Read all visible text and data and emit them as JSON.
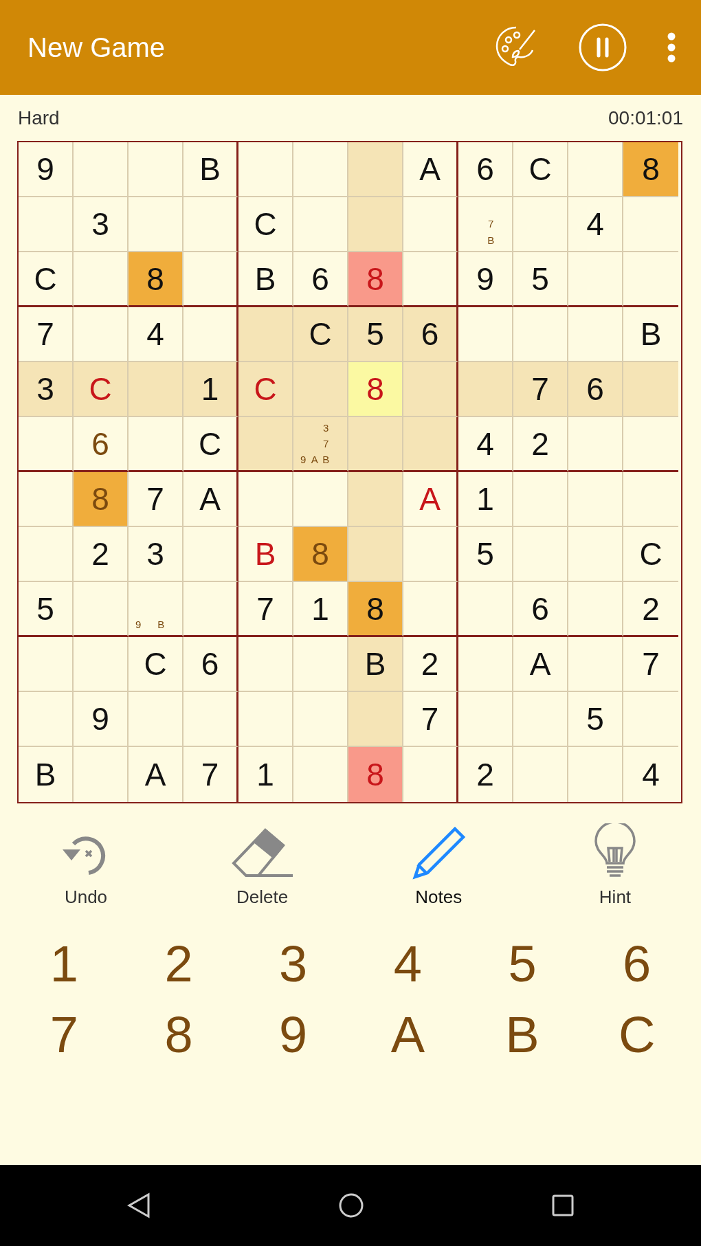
{
  "app_bar": {
    "title": "New Game"
  },
  "status": {
    "difficulty": "Hard",
    "timer": "00:01:01"
  },
  "board": {
    "rows": [
      {
        "cells": [
          {
            "value": "9",
            "kind": "given",
            "matched": false,
            "conflict": false,
            "selected": false
          },
          {
            "selected": false
          },
          {
            "selected": false
          },
          {
            "value": "B",
            "kind": "given",
            "matched": false,
            "conflict": false,
            "selected": false
          },
          {
            "selected": false
          },
          {
            "selected": false
          },
          {
            "selected": false
          },
          {
            "value": "A",
            "kind": "given",
            "matched": false,
            "conflict": false,
            "selected": false
          },
          {
            "value": "6",
            "kind": "given",
            "matched": false,
            "conflict": false,
            "selected": false
          },
          {
            "value": "C",
            "kind": "given",
            "matched": false,
            "conflict": false,
            "selected": false
          },
          {
            "selected": false
          },
          {
            "value": "8",
            "kind": "given",
            "matched": true,
            "conflict": false,
            "selected": false
          }
        ]
      },
      {
        "cells": [
          {
            "selected": false
          },
          {
            "value": "3",
            "kind": "given",
            "matched": false,
            "conflict": false,
            "selected": false
          },
          {
            "selected": false
          },
          {
            "selected": false
          },
          {
            "value": "C",
            "kind": "given",
            "matched": false,
            "conflict": false,
            "selected": false
          },
          {
            "selected": false
          },
          {
            "selected": false
          },
          {
            "selected": false
          },
          {
            "notes": [
              "7",
              "B"
            ],
            "selected": false
          },
          {
            "selected": false
          },
          {
            "value": "4",
            "kind": "given",
            "matched": false,
            "conflict": false,
            "selected": false
          },
          {
            "selected": false
          }
        ]
      },
      {
        "cells": [
          {
            "value": "C",
            "kind": "given",
            "matched": false,
            "conflict": false,
            "selected": false
          },
          {
            "selected": false
          },
          {
            "value": "8",
            "kind": "given",
            "matched": true,
            "conflict": false,
            "selected": false
          },
          {
            "selected": false
          },
          {
            "value": "B",
            "kind": "given",
            "matched": false,
            "conflict": false,
            "selected": false
          },
          {
            "value": "6",
            "kind": "given",
            "matched": false,
            "conflict": false,
            "selected": false
          },
          {
            "value": "8",
            "kind": "error",
            "matched": true,
            "conflict": true,
            "selected": false
          },
          {
            "selected": false
          },
          {
            "value": "9",
            "kind": "given",
            "matched": false,
            "conflict": false,
            "selected": false
          },
          {
            "value": "5",
            "kind": "given",
            "matched": false,
            "conflict": false,
            "selected": false
          },
          {
            "selected": false
          },
          {
            "selected": false
          }
        ]
      },
      {
        "cells": [
          {
            "value": "7",
            "kind": "given",
            "matched": false,
            "conflict": false,
            "selected": false
          },
          {
            "selected": false
          },
          {
            "value": "4",
            "kind": "given",
            "matched": false,
            "conflict": false,
            "selected": false
          },
          {
            "selected": false
          },
          {
            "selected": false
          },
          {
            "value": "C",
            "kind": "given",
            "matched": false,
            "conflict": false,
            "selected": false
          },
          {
            "value": "5",
            "kind": "given",
            "matched": false,
            "conflict": false,
            "selected": false
          },
          {
            "value": "6",
            "kind": "given",
            "matched": false,
            "conflict": false,
            "selected": false
          },
          {
            "selected": false
          },
          {
            "selected": false
          },
          {
            "selected": false
          },
          {
            "value": "B",
            "kind": "given",
            "matched": false,
            "conflict": false,
            "selected": false
          }
        ]
      },
      {
        "cells": [
          {
            "value": "3",
            "kind": "given",
            "matched": false,
            "conflict": false,
            "selected": false
          },
          {
            "value": "C",
            "kind": "error",
            "matched": false,
            "conflict": false,
            "selected": false
          },
          {
            "selected": false
          },
          {
            "value": "1",
            "kind": "given",
            "matched": false,
            "conflict": false,
            "selected": false
          },
          {
            "value": "C",
            "kind": "error",
            "matched": false,
            "conflict": false,
            "selected": false
          },
          {
            "selected": false
          },
          {
            "value": "8",
            "kind": "error",
            "matched": false,
            "conflict": false,
            "selected": true
          },
          {
            "selected": false
          },
          {
            "selected": false
          },
          {
            "value": "7",
            "kind": "given",
            "matched": false,
            "conflict": false,
            "selected": false
          },
          {
            "value": "6",
            "kind": "given",
            "matched": false,
            "conflict": false,
            "selected": false
          },
          {
            "selected": false
          }
        ]
      },
      {
        "cells": [
          {
            "selected": false
          },
          {
            "value": "6",
            "kind": "entered",
            "matched": false,
            "conflict": false,
            "selected": false
          },
          {
            "selected": false
          },
          {
            "value": "C",
            "kind": "given",
            "matched": false,
            "conflict": false,
            "selected": false
          },
          {
            "selected": false
          },
          {
            "notes": [
              "3",
              "7",
              "9",
              "A",
              "B"
            ],
            "selected": false
          },
          {
            "selected": false
          },
          {
            "selected": false
          },
          {
            "value": "4",
            "kind": "given",
            "matched": false,
            "conflict": false,
            "selected": false
          },
          {
            "value": "2",
            "kind": "given",
            "matched": false,
            "conflict": false,
            "selected": false
          },
          {
            "selected": false
          },
          {
            "selected": false
          }
        ]
      },
      {
        "cells": [
          {
            "selected": false
          },
          {
            "value": "8",
            "kind": "entered",
            "matched": true,
            "conflict": false,
            "selected": false
          },
          {
            "value": "7",
            "kind": "given",
            "matched": false,
            "conflict": false,
            "selected": false
          },
          {
            "value": "A",
            "kind": "given",
            "matched": false,
            "conflict": false,
            "selected": false
          },
          {
            "selected": false
          },
          {
            "selected": false
          },
          {
            "selected": false
          },
          {
            "value": "A",
            "kind": "error",
            "matched": false,
            "conflict": false,
            "selected": false
          },
          {
            "value": "1",
            "kind": "given",
            "matched": false,
            "conflict": false,
            "selected": false
          },
          {
            "selected": false
          },
          {
            "selected": false
          },
          {
            "selected": false
          }
        ]
      },
      {
        "cells": [
          {
            "selected": false
          },
          {
            "value": "2",
            "kind": "given",
            "matched": false,
            "conflict": false,
            "selected": false
          },
          {
            "value": "3",
            "kind": "given",
            "matched": false,
            "conflict": false,
            "selected": false
          },
          {
            "selected": false
          },
          {
            "value": "B",
            "kind": "error",
            "matched": false,
            "conflict": false,
            "selected": false
          },
          {
            "value": "8",
            "kind": "entered",
            "matched": true,
            "conflict": false,
            "selected": false
          },
          {
            "selected": false
          },
          {
            "selected": false
          },
          {
            "value": "5",
            "kind": "given",
            "matched": false,
            "conflict": false,
            "selected": false
          },
          {
            "selected": false
          },
          {
            "selected": false
          },
          {
            "value": "C",
            "kind": "given",
            "matched": false,
            "conflict": false,
            "selected": false
          }
        ]
      },
      {
        "cells": [
          {
            "value": "5",
            "kind": "given",
            "matched": false,
            "conflict": false,
            "selected": false
          },
          {
            "selected": false
          },
          {
            "notes": [
              "9",
              "B"
            ],
            "selected": false
          },
          {
            "selected": false
          },
          {
            "value": "7",
            "kind": "given",
            "matched": false,
            "conflict": false,
            "selected": false
          },
          {
            "value": "1",
            "kind": "given",
            "matched": false,
            "conflict": false,
            "selected": false
          },
          {
            "value": "8",
            "kind": "given",
            "matched": true,
            "conflict": false,
            "selected": false
          },
          {
            "selected": false
          },
          {
            "selected": false
          },
          {
            "value": "6",
            "kind": "given",
            "matched": false,
            "conflict": false,
            "selected": false
          },
          {
            "selected": false
          },
          {
            "value": "2",
            "kind": "given",
            "matched": false,
            "conflict": false,
            "selected": false
          }
        ]
      },
      {
        "cells": [
          {
            "selected": false
          },
          {
            "selected": false
          },
          {
            "value": "C",
            "kind": "given",
            "matched": false,
            "conflict": false,
            "selected": false
          },
          {
            "value": "6",
            "kind": "given",
            "matched": false,
            "conflict": false,
            "selected": false
          },
          {
            "selected": false
          },
          {
            "selected": false
          },
          {
            "value": "B",
            "kind": "given",
            "matched": false,
            "conflict": false,
            "selected": false
          },
          {
            "value": "2",
            "kind": "given",
            "matched": false,
            "conflict": false,
            "selected": false
          },
          {
            "selected": false
          },
          {
            "value": "A",
            "kind": "given",
            "matched": false,
            "conflict": false,
            "selected": false
          },
          {
            "selected": false
          },
          {
            "value": "7",
            "kind": "given",
            "matched": false,
            "conflict": false,
            "selected": false
          }
        ]
      },
      {
        "cells": [
          {
            "selected": false
          },
          {
            "value": "9",
            "kind": "given",
            "matched": false,
            "conflict": false,
            "selected": false
          },
          {
            "selected": false
          },
          {
            "selected": false
          },
          {
            "selected": false
          },
          {
            "selected": false
          },
          {
            "selected": false
          },
          {
            "value": "7",
            "kind": "given",
            "matched": false,
            "conflict": false,
            "selected": false
          },
          {
            "selected": false
          },
          {
            "selected": false
          },
          {
            "value": "5",
            "kind": "given",
            "matched": false,
            "conflict": false,
            "selected": false
          },
          {
            "selected": false
          }
        ]
      },
      {
        "cells": [
          {
            "value": "B",
            "kind": "given",
            "matched": false,
            "conflict": false,
            "selected": false
          },
          {
            "selected": false
          },
          {
            "value": "A",
            "kind": "given",
            "matched": false,
            "conflict": false,
            "selected": false
          },
          {
            "value": "7",
            "kind": "given",
            "matched": false,
            "conflict": false,
            "selected": false
          },
          {
            "value": "1",
            "kind": "given",
            "matched": false,
            "conflict": false,
            "selected": false
          },
          {
            "selected": false
          },
          {
            "value": "8",
            "kind": "error",
            "matched": true,
            "conflict": true,
            "selected": false
          },
          {
            "selected": false
          },
          {
            "value": "2",
            "kind": "given",
            "matched": false,
            "conflict": false,
            "selected": false
          },
          {
            "selected": false
          },
          {
            "selected": false
          },
          {
            "value": "4",
            "kind": "given",
            "matched": false,
            "conflict": false,
            "selected": false
          }
        ]
      }
    ]
  },
  "tools": [
    {
      "label": "Undo",
      "kind": "undo",
      "selected": false
    },
    {
      "label": "Delete",
      "kind": "delete",
      "selected": false
    },
    {
      "label": "Notes",
      "kind": "notes",
      "selected": true
    },
    {
      "label": "Hint",
      "kind": "hint",
      "selected": false
    }
  ],
  "keypad": [
    "1",
    "2",
    "3",
    "4",
    "5",
    "6",
    "7",
    "8",
    "9",
    "A",
    "B",
    "C"
  ]
}
